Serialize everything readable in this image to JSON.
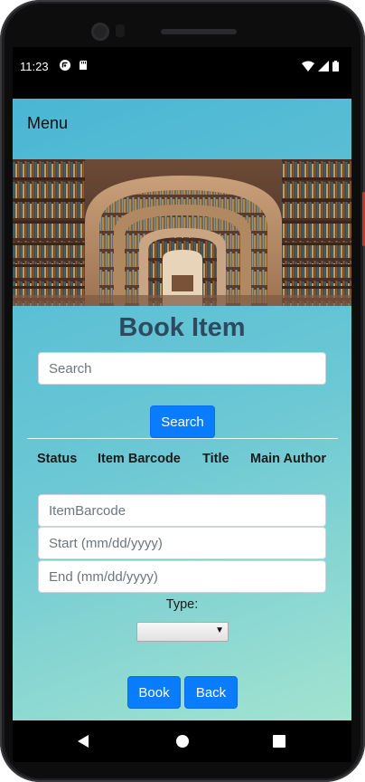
{
  "status": {
    "time": "11:23",
    "left_icons": [
      "cast-icon",
      "sd-card-icon"
    ],
    "right_icons": [
      "wifi-icon",
      "cell-signal-icon",
      "battery-icon"
    ]
  },
  "app": {
    "menu_label": "Menu",
    "page_title": "Book Item",
    "search": {
      "placeholder": "Search",
      "button_label": "Search"
    },
    "table": {
      "headers": [
        "Status",
        "Item Barcode",
        "Title",
        "Main Author"
      ]
    },
    "form": {
      "item_barcode_placeholder": "ItemBarcode",
      "start_placeholder": "Start (mm/dd/yyyy)",
      "end_placeholder": "End (mm/dd/yyyy)",
      "type_label": "Type:",
      "type_selected": ""
    },
    "buttons": {
      "book": "Book",
      "back": "Back"
    }
  },
  "colors": {
    "primary_button": "#0a7cff",
    "title": "#2e4a5e",
    "gradient_start": "#4ab6d4",
    "gradient_end": "#a2e3d0"
  }
}
